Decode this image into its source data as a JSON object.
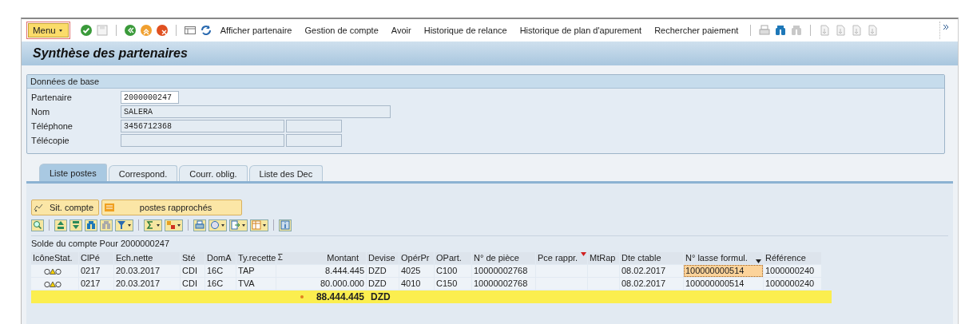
{
  "toolbar": {
    "menu": "Menu",
    "actions": [
      "Afficher partenaire",
      "Gestion de compte",
      "Avoir",
      "Historique de relance",
      "Historique de plan d'apurement",
      "Rechercher paiement"
    ]
  },
  "window": {
    "title": "Synthèse des partenaires"
  },
  "base_data": {
    "title": "Données de base",
    "fields": [
      {
        "label": "Partenaire",
        "value": "2000000247",
        "kind": "short",
        "editable": true
      },
      {
        "label": "Nom",
        "value": "SALERA",
        "kind": "long",
        "editable": false
      },
      {
        "label": "Téléphone",
        "value": "3456712368",
        "kind": "pair",
        "editable": false
      },
      {
        "label": "Télécopie",
        "kind": "pair",
        "editable": false
      }
    ]
  },
  "tabs": [
    {
      "label": "Liste postes",
      "selected": true
    },
    {
      "label": "Correspond.",
      "selected": false
    },
    {
      "label": "Courr. oblig.",
      "selected": false
    },
    {
      "label": "Liste des Dec",
      "selected": false
    }
  ],
  "buttons": [
    {
      "label": "Sit. compte",
      "kind": "account"
    },
    {
      "label": "postes rapprochés",
      "kind": "matched"
    }
  ],
  "table": {
    "title": "Solde du compte Pour 2000000247",
    "columns": [
      {
        "label": "IcôneStat.",
        "totaled": false,
        "filtered": false,
        "sorted": false
      },
      {
        "label": "ClPé",
        "totaled": false,
        "filtered": false,
        "sorted": false
      },
      {
        "label": "Ech.nette",
        "totaled": false,
        "filtered": false,
        "sorted": false
      },
      {
        "label": "Sté",
        "totaled": false,
        "filtered": false,
        "sorted": false
      },
      {
        "label": "DomA",
        "totaled": false,
        "filtered": false,
        "sorted": false
      },
      {
        "label": "Ty.recette",
        "totaled": false,
        "filtered": false,
        "sorted": false
      },
      {
        "label": "Montant",
        "totaled": true,
        "filtered": false,
        "sorted": false
      },
      {
        "label": "Devise",
        "totaled": false,
        "filtered": false,
        "sorted": false
      },
      {
        "label": "OpérPr",
        "totaled": false,
        "filtered": false,
        "sorted": false
      },
      {
        "label": "OPart.",
        "totaled": false,
        "filtered": false,
        "sorted": false
      },
      {
        "label": "N° de pièce",
        "totaled": false,
        "filtered": false,
        "sorted": false
      },
      {
        "label": "Pce rappr.",
        "totaled": false,
        "filtered": true,
        "sorted": false
      },
      {
        "label": "MtRap",
        "totaled": false,
        "filtered": false,
        "sorted": false
      },
      {
        "label": "Dte ctable",
        "totaled": false,
        "filtered": false,
        "sorted": false
      },
      {
        "label": "N° lasse formul.",
        "totaled": false,
        "filtered": false,
        "sorted": true
      },
      {
        "label": "Référence",
        "totaled": false,
        "filtered": false,
        "sorted": false
      }
    ],
    "rows": [
      {
        "cells": [
          {
            "warning": true,
            "selected": false
          },
          {
            "text": "0217",
            "selected": false
          },
          {
            "text": "20.03.2017",
            "selected": false
          },
          {
            "text": "CDI",
            "selected": false
          },
          {
            "text": "16C",
            "selected": false
          },
          {
            "text": "TAP",
            "selected": false
          },
          {
            "text": "8.444.445",
            "selected": false
          },
          {
            "text": "DZD",
            "selected": false
          },
          {
            "text": "4025",
            "selected": false
          },
          {
            "text": "C100",
            "selected": false
          },
          {
            "text": "10000002768",
            "selected": false
          },
          {
            "selected": false
          },
          {
            "selected": false
          },
          {
            "text": "08.02.2017",
            "selected": false
          },
          {
            "text": "100000000514",
            "selected": true
          },
          {
            "text": "1000000240",
            "selected": false
          }
        ]
      },
      {
        "cells": [
          {
            "warning": true,
            "selected": false
          },
          {
            "text": "0217",
            "selected": false
          },
          {
            "text": "20.03.2017",
            "selected": false
          },
          {
            "text": "CDI",
            "selected": false
          },
          {
            "text": "16C",
            "selected": false
          },
          {
            "text": "TVA",
            "selected": false
          },
          {
            "text": "80.000.000",
            "selected": false
          },
          {
            "text": "DZD",
            "selected": false
          },
          {
            "text": "4010",
            "selected": false
          },
          {
            "text": "C150",
            "selected": false
          },
          {
            "text": "10000002768",
            "selected": false
          },
          {
            "selected": false
          },
          {
            "selected": false
          },
          {
            "text": "08.02.2017",
            "selected": false
          },
          {
            "text": "100000000514",
            "selected": false
          },
          {
            "text": "1000000240",
            "selected": false
          }
        ]
      }
    ],
    "total": {
      "amount": "88.444.445",
      "currency": "DZD"
    }
  }
}
